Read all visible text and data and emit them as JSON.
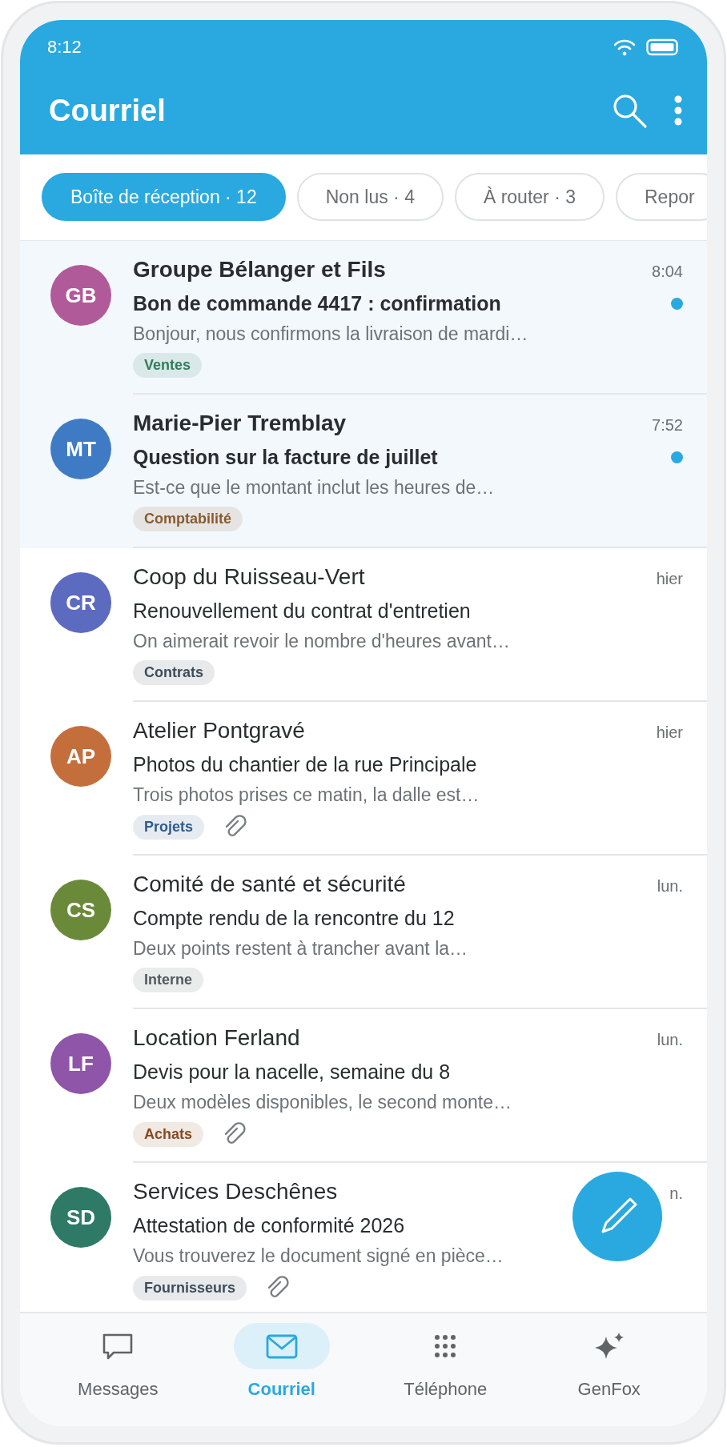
{
  "status_bar": {
    "time": "8:12"
  },
  "app_bar": {
    "title": "Courriel"
  },
  "filters": [
    {
      "label": "Boîte de réception · 12",
      "selected": true
    },
    {
      "label": "Non lus · 4",
      "selected": false
    },
    {
      "label": "À router · 3",
      "selected": false
    },
    {
      "label": "Repor",
      "selected": false
    }
  ],
  "messages": [
    {
      "initials": "GB",
      "color": "#b05a9a",
      "sender": "Groupe Bélanger et Fils",
      "time": "8:04",
      "subject": "Bon de commande 4417 : confirmation",
      "preview": "Bonjour, nous confirmons la livraison de mardi…",
      "unread": true,
      "tag": {
        "label": "Ventes",
        "color": "#2e7d5b"
      },
      "attachment": false
    },
    {
      "initials": "MT",
      "color": "#3f7bc4",
      "sender": "Marie-Pier Tremblay",
      "time": "7:52",
      "subject": "Question sur la facture de juillet",
      "preview": "Est-ce que le montant inclut les heures de…",
      "unread": true,
      "tag": {
        "label": "Comptabilité",
        "color": "#8a5a2b"
      },
      "attachment": false
    },
    {
      "initials": "CR",
      "color": "#5c6bc0",
      "sender": "Coop du Ruisseau-Vert",
      "time": "hier",
      "subject": "Renouvellement du contrat d'entretien",
      "preview": "On aimerait revoir le nombre d'heures avant…",
      "unread": false,
      "tag": {
        "label": "Contrats",
        "color": "#3e4d5c"
      },
      "attachment": false
    },
    {
      "initials": "AP",
      "color": "#c46e3c",
      "sender": "Atelier Pontgravé",
      "time": "hier",
      "subject": "Photos du chantier de la rue Principale",
      "preview": "Trois photos prises ce matin, la dalle est…",
      "unread": false,
      "tag": {
        "label": "Projets",
        "color": "#2f5d8a"
      },
      "attachment": true
    },
    {
      "initials": "CS",
      "color": "#6a8a3a",
      "sender": "Comité de santé et sécurité",
      "time": "lun.",
      "subject": "Compte rendu de la rencontre du 12",
      "preview": "Deux points restent à trancher avant la…",
      "unread": false,
      "tag": {
        "label": "Interne",
        "color": "#555a5e"
      },
      "attachment": false
    },
    {
      "initials": "LF",
      "color": "#8e55a8",
      "sender": "Location Ferland",
      "time": "lun.",
      "subject": "Devis pour la nacelle, semaine du 8",
      "preview": "Deux modèles disponibles, le second monte…",
      "unread": false,
      "tag": {
        "label": "Achats",
        "color": "#8a4a20"
      },
      "attachment": true
    },
    {
      "initials": "SD",
      "color": "#2e7a66",
      "sender": "Services Deschênes",
      "time": "n.",
      "subject": "Attestation de conformité 2026",
      "preview": "Vous trouverez le document signé en pièce…",
      "unread": false,
      "tag": {
        "label": "Fournisseurs",
        "color": "#3e4d5c"
      },
      "attachment": true
    }
  ],
  "bottom_nav": [
    {
      "kind": "chat",
      "label": "Messages",
      "selected": false
    },
    {
      "kind": "mail",
      "label": "Courriel",
      "selected": true
    },
    {
      "kind": "dialpad",
      "label": "Téléphone",
      "selected": false
    },
    {
      "kind": "sparkle",
      "label": "GenFox",
      "selected": false
    }
  ]
}
